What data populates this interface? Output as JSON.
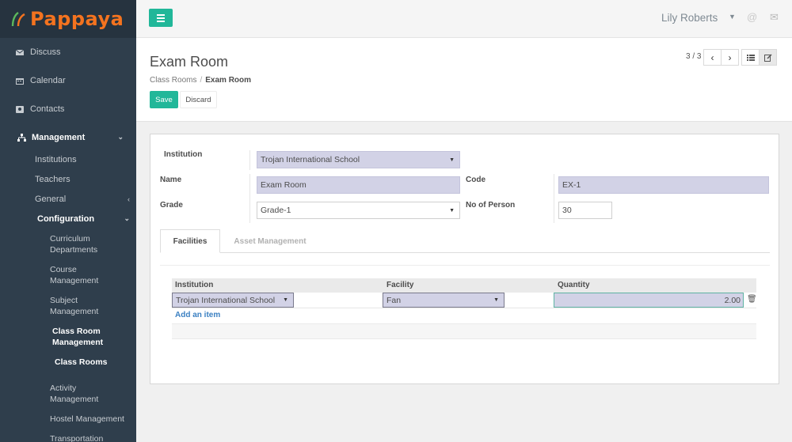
{
  "app": {
    "brand": "Pappaya"
  },
  "sidebar": {
    "top_items": [
      {
        "label": "Discuss",
        "icon": "envelope-icon"
      },
      {
        "label": "Calendar",
        "icon": "calendar-icon"
      },
      {
        "label": "Contacts",
        "icon": "contact-card-icon"
      }
    ],
    "management": {
      "label": "Management",
      "icon": "sitemap-icon"
    },
    "sub_items": [
      "Institutions",
      "Teachers",
      "General"
    ],
    "configuration": "Configuration",
    "config_items": [
      {
        "line1": "Curriculum",
        "line2": "Departments"
      },
      {
        "line1": "Course",
        "line2": "Management"
      },
      {
        "line1": "Subject",
        "line2": "Management"
      },
      {
        "line1": "Class Room",
        "line2": "Management"
      },
      {
        "line1": "Class Rooms",
        "line2": ""
      },
      {
        "line1": "Activity",
        "line2": "Management"
      },
      {
        "line1": "Hostel Management",
        "line2": ""
      },
      {
        "line1": "Transportation",
        "line2": ""
      }
    ]
  },
  "topbar": {
    "user_name": "Lily Roberts",
    "menu_icon": "hamburger-icon",
    "at_icon": "at-icon",
    "chat_icon": "chat-icon"
  },
  "control": {
    "title": "Exam Room",
    "breadcrumb": {
      "parent": "Class Rooms",
      "separator": "/",
      "current": "Exam Room"
    },
    "save_label": "Save",
    "discard_label": "Discard",
    "pager": "3 / 3"
  },
  "form": {
    "institution_label": "Institution",
    "institution_value": "Trojan International School",
    "name_label": "Name",
    "name_value": "Exam Room",
    "code_label": "Code",
    "code_value": "EX-1",
    "grade_label": "Grade",
    "grade_value": "Grade-1",
    "persons_label": "No of Person",
    "persons_value": "30"
  },
  "tabs": [
    {
      "label": "Facilities",
      "active": true
    },
    {
      "label": "Asset Management",
      "active": false
    }
  ],
  "facilities": {
    "columns": [
      "Institution",
      "Facility",
      "Quantity"
    ],
    "rows": [
      {
        "institution": "Trojan International School",
        "facility": "Fan",
        "quantity": "2.00"
      }
    ],
    "add_item": "Add an item"
  },
  "colors": {
    "accent": "#21b799",
    "sidebar": "#2f3e4c",
    "brand": "#f4731f",
    "required_field": "#d2d2e6",
    "link": "#3b80c2"
  }
}
